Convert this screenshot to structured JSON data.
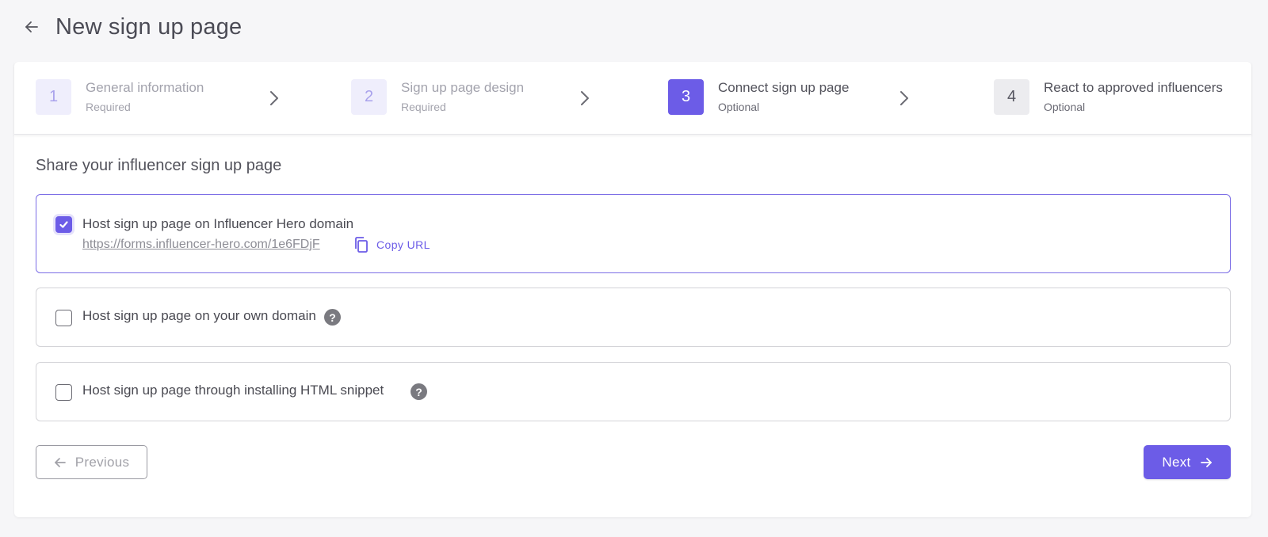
{
  "header": {
    "title": "New sign up page",
    "back_icon": "arrow-left-icon"
  },
  "stepper": {
    "steps": [
      {
        "number": "1",
        "title": "General information",
        "subtitle": "Required",
        "state": "completed"
      },
      {
        "number": "2",
        "title": "Sign up page design",
        "subtitle": "Required",
        "state": "completed"
      },
      {
        "number": "3",
        "title": "Connect sign up page",
        "subtitle": "Optional",
        "state": "active"
      },
      {
        "number": "4",
        "title": "React to approved influencers",
        "subtitle": "Optional",
        "state": "upcoming"
      }
    ],
    "separator_icon": "chevron-right-icon"
  },
  "main": {
    "section_title": "Share your influencer sign up page",
    "options": [
      {
        "label": "Host sign up page on Influencer Hero domain",
        "checked": true,
        "url": "https://forms.influencer-hero.com/1e6FDjF",
        "copy_label": "Copy URL",
        "copy_icon": "copy-icon"
      },
      {
        "label": "Host sign up page on your own domain",
        "checked": false,
        "help_icon": "question-circle-icon",
        "help_glyph": "?"
      },
      {
        "label": "Host sign up page through installing HTML snippet",
        "checked": false,
        "help_icon": "question-circle-icon",
        "help_glyph": "?"
      }
    ]
  },
  "footer": {
    "previous_label": "Previous",
    "next_label": "Next"
  },
  "colors": {
    "accent": "#6c5ce7",
    "accent_light": "#efeefc",
    "background": "#f6f6f8",
    "border": "#d4d4d8"
  }
}
